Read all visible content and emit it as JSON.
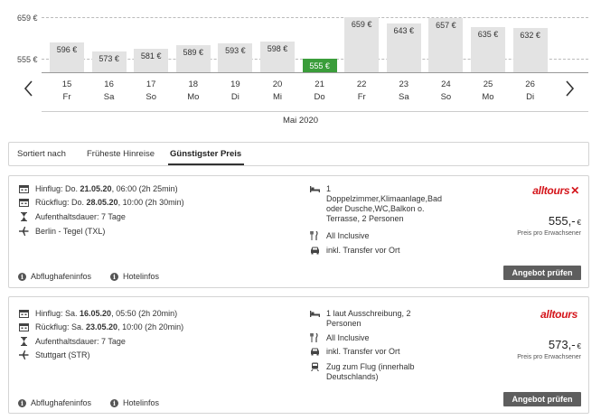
{
  "calendar": {
    "grid": {
      "upper": "659 €",
      "lower": "555 €"
    },
    "days": [
      {
        "num": "15",
        "wd": "Fr",
        "price": "596 €",
        "value": 596
      },
      {
        "num": "16",
        "wd": "Sa",
        "price": "573 €",
        "value": 573
      },
      {
        "num": "17",
        "wd": "So",
        "price": "581 €",
        "value": 581
      },
      {
        "num": "18",
        "wd": "Mo",
        "price": "589 €",
        "value": 589
      },
      {
        "num": "19",
        "wd": "Di",
        "price": "593 €",
        "value": 593
      },
      {
        "num": "20",
        "wd": "Mi",
        "price": "598 €",
        "value": 598
      },
      {
        "num": "21",
        "wd": "Do",
        "price": "555 €",
        "value": 555,
        "selected": true
      },
      {
        "num": "22",
        "wd": "Fr",
        "price": "659 €",
        "value": 659
      },
      {
        "num": "23",
        "wd": "Sa",
        "price": "643 €",
        "value": 643
      },
      {
        "num": "24",
        "wd": "So",
        "price": "657 €",
        "value": 657
      },
      {
        "num": "25",
        "wd": "Mo",
        "price": "635 €",
        "value": 635
      },
      {
        "num": "26",
        "wd": "Di",
        "price": "632 €",
        "value": 632
      }
    ],
    "month": "Mai 2020",
    "colors": {
      "bar": "#e3e3e3",
      "selected": "#3a9d3a"
    }
  },
  "sort": {
    "lead": "Sortiert nach",
    "options": [
      "Früheste Hinreise",
      "Günstigster Preis"
    ],
    "active": 1
  },
  "offers": [
    {
      "outbound_prefix": "Hinflug: Do. ",
      "outbound_date": "21.05.20",
      "outbound_rest": ", 06:00 (2h 25min)",
      "return_prefix": "Rückflug: Do. ",
      "return_date": "28.05.20",
      "return_rest": ", 10:00 (2h 30min)",
      "stay": "Aufenthaltsdauer: 7 Tage",
      "airport": "Berlin - Tegel (TXL)",
      "room": [
        "1",
        "Doppelzimmer,Klimaanlage,Bad",
        "oder Dusche,WC,Balkon o.",
        "Terrasse, 2 Personen"
      ],
      "board": "All Inclusive",
      "transfer": "inkl. Transfer vor Ort",
      "extra": [],
      "logo": "alltours",
      "logo_x": "✕",
      "price": "555,-",
      "currency": "€",
      "price_note": "Preis pro Erwachsener",
      "airport_info": "Abflughafeninfos",
      "hotel_info": "Hotelinfos",
      "cta": "Angebot prüfen"
    },
    {
      "outbound_prefix": "Hinflug: Sa. ",
      "outbound_date": "16.05.20",
      "outbound_rest": ", 05:50 (2h 20min)",
      "return_prefix": "Rückflug: Sa. ",
      "return_date": "23.05.20",
      "return_rest": ", 10:00 (2h 20min)",
      "stay": "Aufenthaltsdauer: 7 Tage",
      "airport": "Stuttgart (STR)",
      "room": [
        "1 laut Ausschreibung, 2",
        "Personen"
      ],
      "board": "All Inclusive",
      "transfer": "inkl. Transfer vor Ort",
      "extra": [
        "Zug zum Flug (innerhalb",
        "Deutschlands)"
      ],
      "logo": "alltours",
      "logo_x": "",
      "price": "573,-",
      "currency": "€",
      "price_note": "Preis pro Erwachsener",
      "airport_info": "Abflughafeninfos",
      "hotel_info": "Hotelinfos",
      "cta": "Angebot prüfen"
    }
  ]
}
